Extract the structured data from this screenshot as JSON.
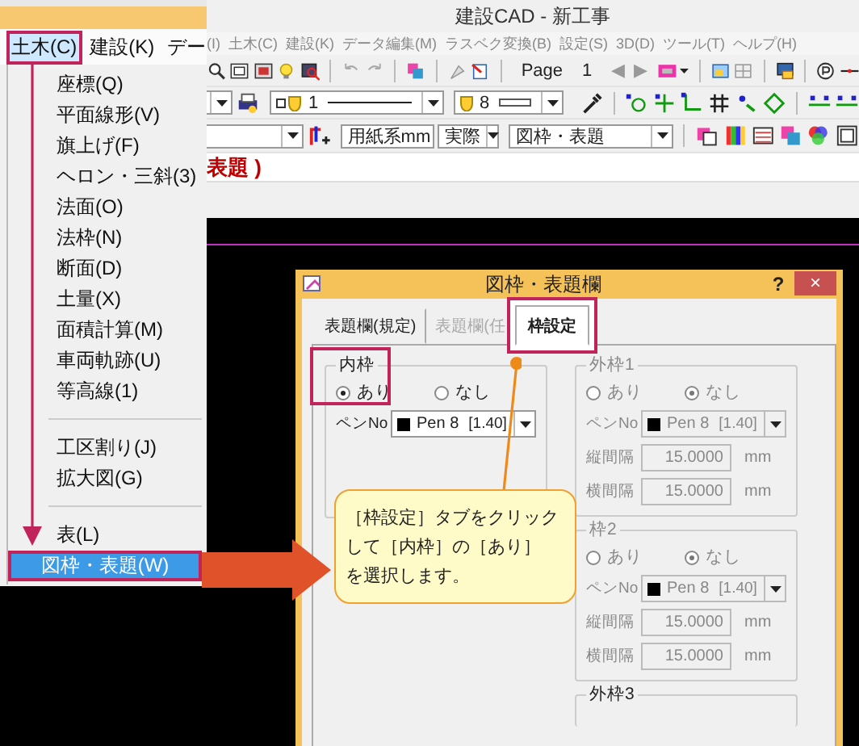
{
  "window": {
    "title": "建設CAD - 新工事"
  },
  "menu_bar": [
    "(I)",
    "土木(C)",
    "建設(K)",
    "データ編集(M)",
    "ラスベク変換(B)",
    "設定(S)",
    "3D(D)",
    "ツール(T)",
    "ヘルプ(H)"
  ],
  "toolbar": {
    "page_label": "Page",
    "page_number": "1",
    "prev": "◀",
    "next": "▶"
  },
  "line_type": {
    "value": "1"
  },
  "line_width": {
    "value": "8"
  },
  "paper_units": {
    "value": "用紙系mm"
  },
  "scale_mode": {
    "value": "実際"
  },
  "layer": {
    "value": "図枠・表題"
  },
  "drawing_title": "表題 )",
  "zoomed_menu_bar": [
    {
      "label": "土木(C)",
      "selected": true,
      "highlighted": true
    },
    {
      "label": "建設(K)",
      "selected": false,
      "highlighted": false
    },
    {
      "label": "デー",
      "selected": false,
      "highlighted": false
    }
  ],
  "dropdown": [
    {
      "kind": "item",
      "label": "座標(Q)",
      "selected": false,
      "highlighted": false
    },
    {
      "kind": "item",
      "label": "平面線形(V)",
      "selected": false,
      "highlighted": false
    },
    {
      "kind": "item",
      "label": "旗上げ(F)",
      "selected": false,
      "highlighted": false
    },
    {
      "kind": "item",
      "label": "ヘロン・三斜(3)",
      "selected": false,
      "highlighted": false
    },
    {
      "kind": "item",
      "label": "法面(O)",
      "selected": false,
      "highlighted": false
    },
    {
      "kind": "item",
      "label": "法枠(N)",
      "selected": false,
      "highlighted": false
    },
    {
      "kind": "item",
      "label": "断面(D)",
      "selected": false,
      "highlighted": false
    },
    {
      "kind": "item",
      "label": "土量(X)",
      "selected": false,
      "highlighted": false
    },
    {
      "kind": "item",
      "label": "面積計算(M)",
      "selected": false,
      "highlighted": false
    },
    {
      "kind": "item",
      "label": "車両軌跡(U)",
      "selected": false,
      "highlighted": false
    },
    {
      "kind": "item",
      "label": "等高線(1)",
      "selected": false,
      "highlighted": false
    },
    {
      "kind": "separator"
    },
    {
      "kind": "item",
      "label": "工区割り(J)",
      "selected": false,
      "highlighted": false
    },
    {
      "kind": "item",
      "label": "拡大図(G)",
      "selected": false,
      "highlighted": false
    },
    {
      "kind": "separator"
    },
    {
      "kind": "item",
      "label": "表(L)",
      "selected": false,
      "highlighted": false
    },
    {
      "kind": "item",
      "label": "図枠・表題(W)",
      "selected": true,
      "highlighted": true
    }
  ],
  "dialog": {
    "title": "図枠・表題欄",
    "help": "?",
    "close": "×",
    "tabs": [
      {
        "label": "表題欄(規定)",
        "selected": false,
        "disabled": false,
        "highlighted": false
      },
      {
        "label": "表題欄(任",
        "selected": false,
        "disabled": true,
        "highlighted": false
      },
      {
        "label": "枠設定",
        "selected": true,
        "disabled": false,
        "highlighted": true
      }
    ],
    "groups": [
      {
        "title": "内枠",
        "disabled": false,
        "highlighted": true,
        "options": [
          {
            "label": "あり",
            "selected": true
          },
          {
            "label": "なし",
            "selected": false
          }
        ],
        "pen_label": "ペンNo",
        "pen": "Pen 8",
        "pen_width": "[1.40]"
      },
      {
        "title": "外枠1",
        "disabled": true,
        "highlighted": false,
        "options": [
          {
            "label": "あり",
            "selected": false
          },
          {
            "label": "なし",
            "selected": true
          }
        ],
        "pen_label": "ペンNo",
        "pen": "Pen 8",
        "pen_width": "[1.40]",
        "spacing": [
          {
            "label": "縦間隔",
            "value": "15.0000",
            "unit": "mm"
          },
          {
            "label": "横間隔",
            "value": "15.0000",
            "unit": "mm"
          }
        ]
      },
      {
        "title": "枠2",
        "disabled": true,
        "highlighted": false,
        "options": [
          {
            "label": "あり",
            "selected": false
          },
          {
            "label": "なし",
            "selected": true
          }
        ],
        "pen_label": "ペンNo",
        "pen": "Pen 8",
        "pen_width": "[1.40]",
        "spacing": [
          {
            "label": "縦間隔",
            "value": "15.0000",
            "unit": "mm"
          },
          {
            "label": "横間隔",
            "value": "15.0000",
            "unit": "mm"
          }
        ]
      },
      {
        "title": "外枠3",
        "disabled": false,
        "highlighted": false
      }
    ]
  },
  "callout": {
    "lines": [
      "［枠設定］タブをクリック",
      "して［内枠］の［あり］",
      "を選択します。"
    ]
  }
}
